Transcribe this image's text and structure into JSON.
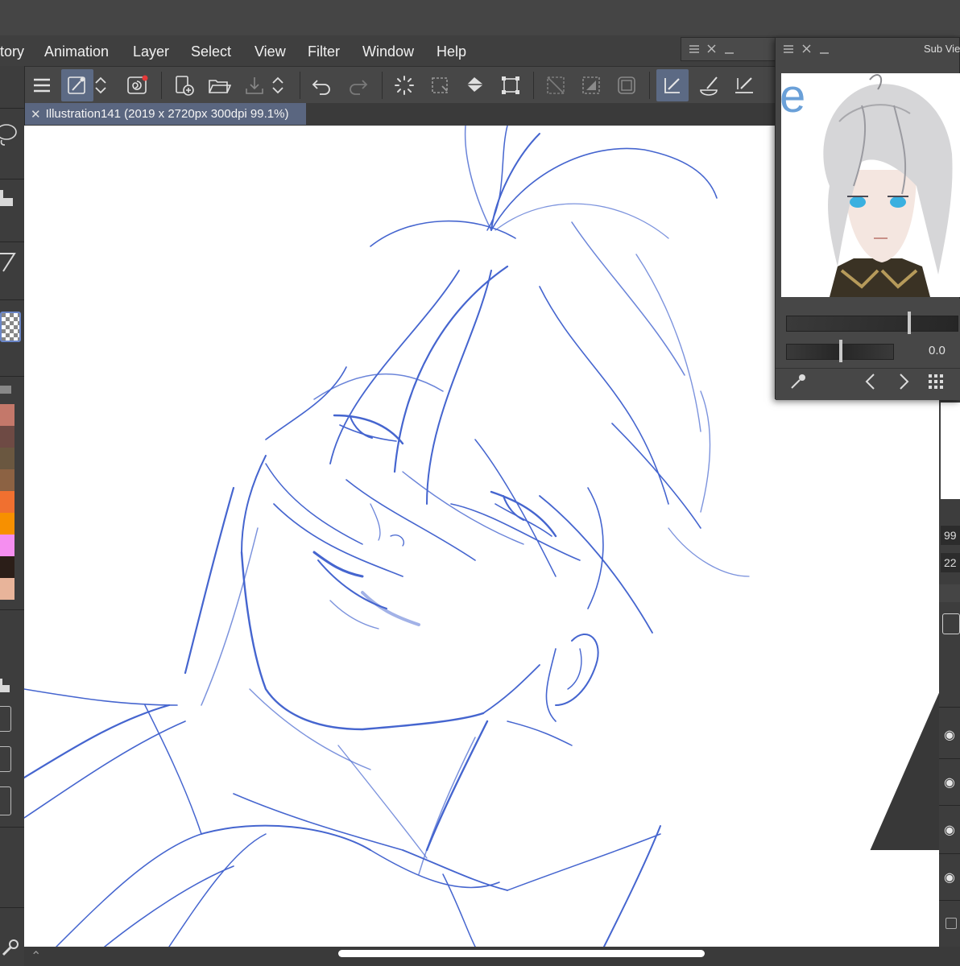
{
  "menu": {
    "items": [
      "tory",
      "Animation",
      "Layer",
      "Select",
      "View",
      "Filter",
      "Window",
      "Help"
    ]
  },
  "document_tab": {
    "title": "Illustration141 (2019 x 2720px 300dpi 99.1%)"
  },
  "sub_view": {
    "title": "Sub Vie",
    "rotation_value": "0.0",
    "partial_letter": "e"
  },
  "right_panel": {
    "field1": "99",
    "field2": "22"
  },
  "palette": {
    "swatches": [
      "#c4786a",
      "#6e4a44",
      "#6a5740",
      "#8c6243",
      "#f07030",
      "#f79000",
      "#f58ef0",
      "#2b1e18",
      "#e8b49a"
    ]
  },
  "colors": {
    "accent": "#5c6a84",
    "sketch": "#3f5fd0"
  },
  "icons": {
    "toolbar": [
      "hamburger-icon",
      "subtool-pen-icon",
      "up-down-icon",
      "swirl-icon",
      "new-canvas-icon",
      "open-folder-icon",
      "save-icon",
      "up-down-icon",
      "undo-icon",
      "redo-icon",
      "loading-spinner-icon",
      "selection-icon",
      "fill-bucket-icon",
      "transform-icon",
      "deselect-icon",
      "invert-selection-icon",
      "frame-icon",
      "pen-active-icon",
      "brush-icon",
      "ruler-pen-icon"
    ]
  }
}
